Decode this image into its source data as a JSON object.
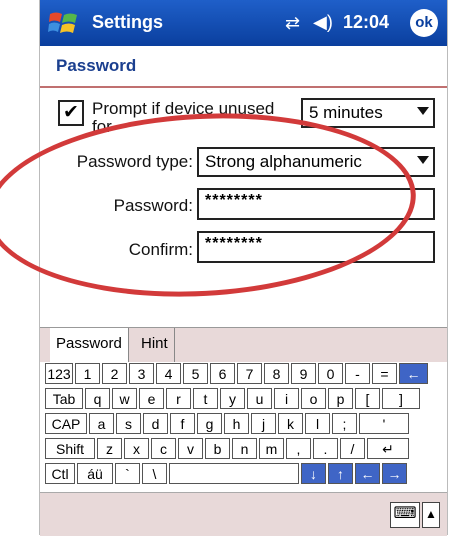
{
  "titlebar": {
    "app_title": "Settings",
    "clock": "12:04",
    "ok_label": "ok",
    "start_icon": "windows-flag-icon",
    "sync_icon": "connectivity-icon",
    "volume_icon": "speaker-icon"
  },
  "page": {
    "title": "Password"
  },
  "prompt": {
    "checked": true,
    "label": "Prompt if device unused for",
    "duration_value": "5 minutes"
  },
  "form": {
    "type_label": "Password type:",
    "type_value": "Strong alphanumeric",
    "password_label": "Password:",
    "password_value": "********",
    "confirm_label": "Confirm:",
    "confirm_value": "********"
  },
  "tabs": [
    {
      "label": "Password",
      "active": true
    },
    {
      "label": "Hint",
      "active": false
    }
  ],
  "keyboard": {
    "rows": [
      [
        "123",
        "1",
        "2",
        "3",
        "4",
        "5",
        "6",
        "7",
        "8",
        "9",
        "0",
        "-",
        "=",
        "←"
      ],
      [
        "Tab",
        "q",
        "w",
        "e",
        "r",
        "t",
        "y",
        "u",
        "i",
        "o",
        "p",
        "[",
        "]"
      ],
      [
        "CAP",
        "a",
        "s",
        "d",
        "f",
        "g",
        "h",
        "j",
        "k",
        "l",
        ";",
        "'"
      ],
      [
        "Shift",
        "z",
        "x",
        "c",
        "v",
        "b",
        "n",
        "m",
        ",",
        ".",
        "/",
        "↵"
      ],
      [
        "Ctl",
        "áü",
        "`",
        "\\",
        "",
        "↓",
        "↑",
        "←",
        "→"
      ]
    ]
  },
  "colors": {
    "titlebar": "#0a3f9e",
    "annotation_ellipse": "#d23a3a",
    "tab_strip": "#e8d9d9"
  }
}
